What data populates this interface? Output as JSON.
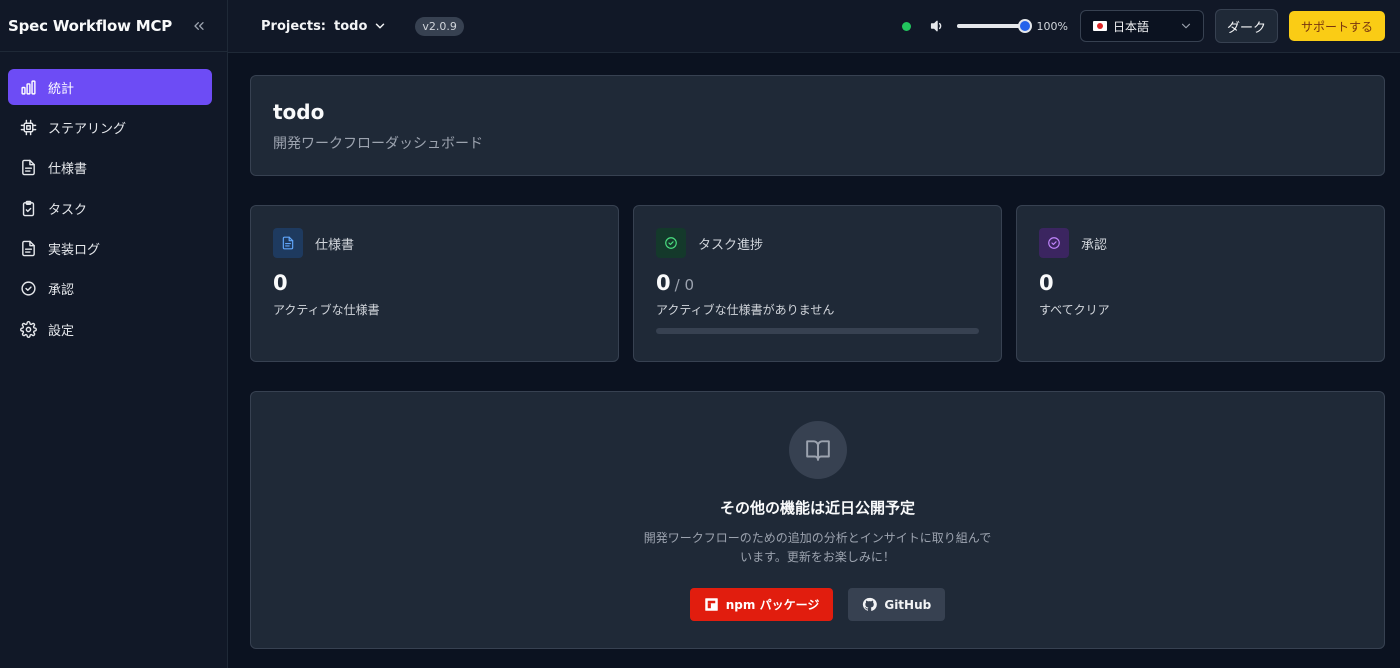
{
  "sidebar": {
    "title": "Spec Workflow MCP",
    "items": [
      {
        "label": "統計",
        "icon": "bar-chart-icon",
        "active": true
      },
      {
        "label": "ステアリング",
        "icon": "chip-icon"
      },
      {
        "label": "仕様書",
        "icon": "document-icon"
      },
      {
        "label": "タスク",
        "icon": "clipboard-check-icon"
      },
      {
        "label": "実装ログ",
        "icon": "document-icon"
      },
      {
        "label": "承認",
        "icon": "check-circle-icon"
      },
      {
        "label": "設定",
        "icon": "gear-icon"
      }
    ]
  },
  "topbar": {
    "projects_label": "Projects:",
    "project_name": "todo",
    "version": "v2.0.9",
    "volume_percent": 100,
    "volume_label": "100%",
    "language": "日本語",
    "theme_label": "ダーク",
    "support_label": "サポートする"
  },
  "hero": {
    "title": "todo",
    "subtitle": "開発ワークフローダッシュボード"
  },
  "stats": {
    "specs": {
      "label": "仕様書",
      "value": "0",
      "sub": "アクティブな仕様書"
    },
    "tasks": {
      "label": "タスク進捗",
      "value": "0",
      "total": "/ 0",
      "sub": "アクティブな仕様書がありません",
      "progress_percent": 0
    },
    "approvals": {
      "label": "承認",
      "value": "0",
      "sub": "すべてクリア"
    }
  },
  "coming_soon": {
    "title": "その他の機能は近日公開予定",
    "description": "開発ワークフローのための追加の分析とインサイトに取り組んでいます。更新をお楽しみに！",
    "npm_label": "npm パッケージ",
    "github_label": "GitHub"
  },
  "colors": {
    "accent": "#6d4cf5",
    "support": "#facc15",
    "npm": "#e11d0e",
    "status_online": "#22c55e"
  }
}
